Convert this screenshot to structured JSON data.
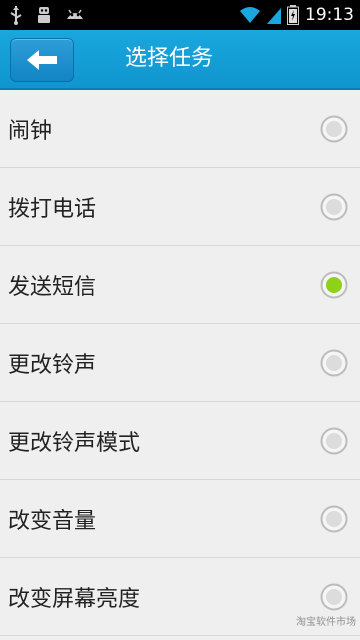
{
  "status_bar": {
    "time": "19:13",
    "icons": [
      "usb-icon",
      "robot-icon",
      "android-icon",
      "wifi-icon",
      "signal-icon",
      "battery-icon"
    ]
  },
  "header": {
    "title": "选择任务",
    "back_icon": "back-arrow-icon"
  },
  "tasks": [
    {
      "label": "闹钟",
      "selected": false
    },
    {
      "label": "拨打电话",
      "selected": false
    },
    {
      "label": "发送短信",
      "selected": true
    },
    {
      "label": "更改铃声",
      "selected": false
    },
    {
      "label": "更改铃声模式",
      "selected": false
    },
    {
      "label": "改变音量",
      "selected": false
    },
    {
      "label": "改变屏幕亮度",
      "selected": false
    }
  ],
  "watermark": "淘宝软件市场",
  "colors": {
    "accent": "#1aa7de",
    "selected_radio": "#8fd11a"
  }
}
